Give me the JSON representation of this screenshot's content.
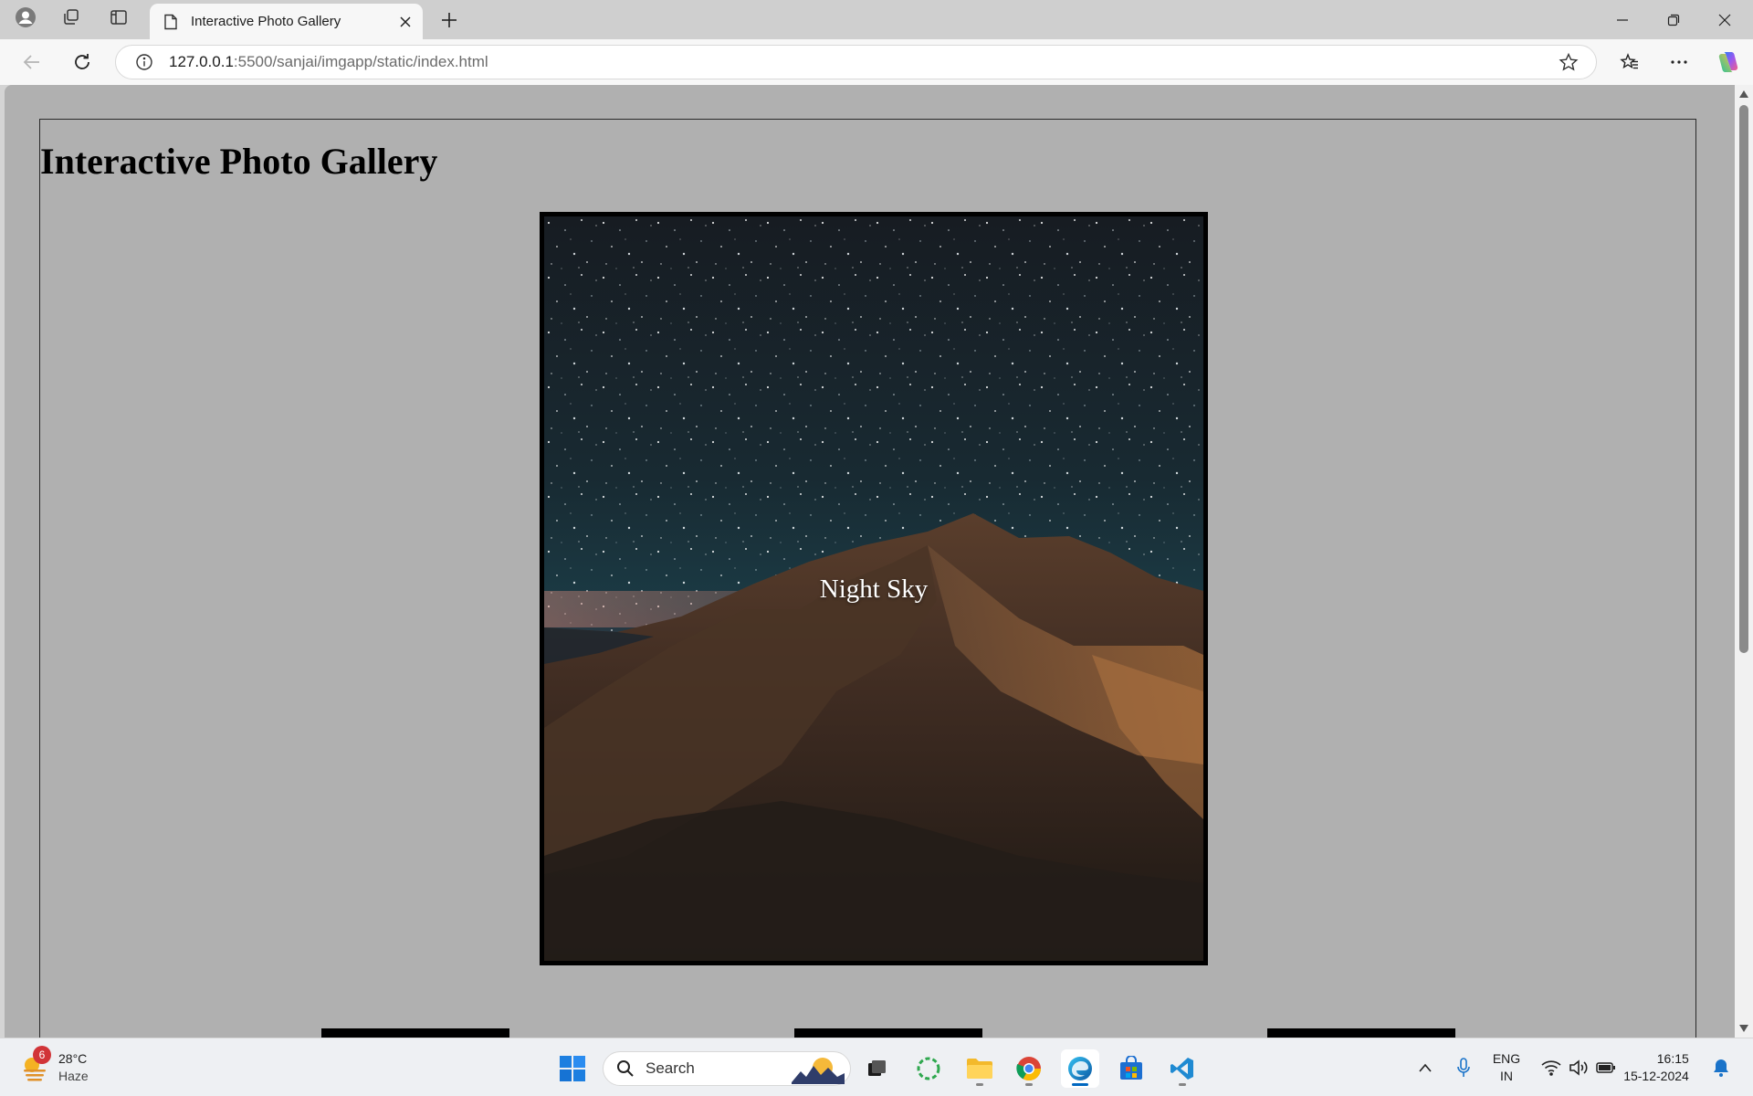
{
  "browser": {
    "tab_title": "Interactive Photo Gallery",
    "url_host": "127.0.0.1",
    "url_rest": ":5500/sanjai/imgapp/static/index.html"
  },
  "page": {
    "title": "Interactive Photo Gallery",
    "main_caption": "Night Sky",
    "background": "#b0b0b0"
  },
  "taskbar": {
    "weather_temp": "28°C",
    "weather_condition": "Haze",
    "weather_badge": "6",
    "search_label": "Search",
    "lang_line1": "ENG",
    "lang_line2": "IN",
    "time": "16:15",
    "date": "15-12-2024"
  },
  "icons": {
    "profile": "profile-icon",
    "workspaces": "workspaces-icon",
    "tab_actions": "vertical-tabs-icon",
    "page": "page-icon",
    "close": "close-icon",
    "new_tab": "plus-icon",
    "back": "back-arrow-icon",
    "refresh": "refresh-icon",
    "info": "info-icon",
    "favorite": "star-icon",
    "favorites": "favorites-icon",
    "more": "more-icon",
    "copilot": "copilot-icon"
  },
  "colors": {
    "accent": "#0067c0",
    "badge": "#d13438"
  }
}
